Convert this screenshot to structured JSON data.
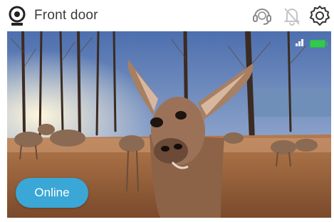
{
  "header": {
    "title": "Front door",
    "camera_icon": "camera-icon",
    "support_icon": "headset-icon",
    "bell_icon": "bell-off-icon",
    "settings_icon": "gear-icon"
  },
  "feed": {
    "signal_icon": "signal-icon",
    "battery_icon": "battery-icon",
    "battery_color": "#31c94f",
    "status_label": "Online",
    "status_color": "#3aa7d6"
  }
}
